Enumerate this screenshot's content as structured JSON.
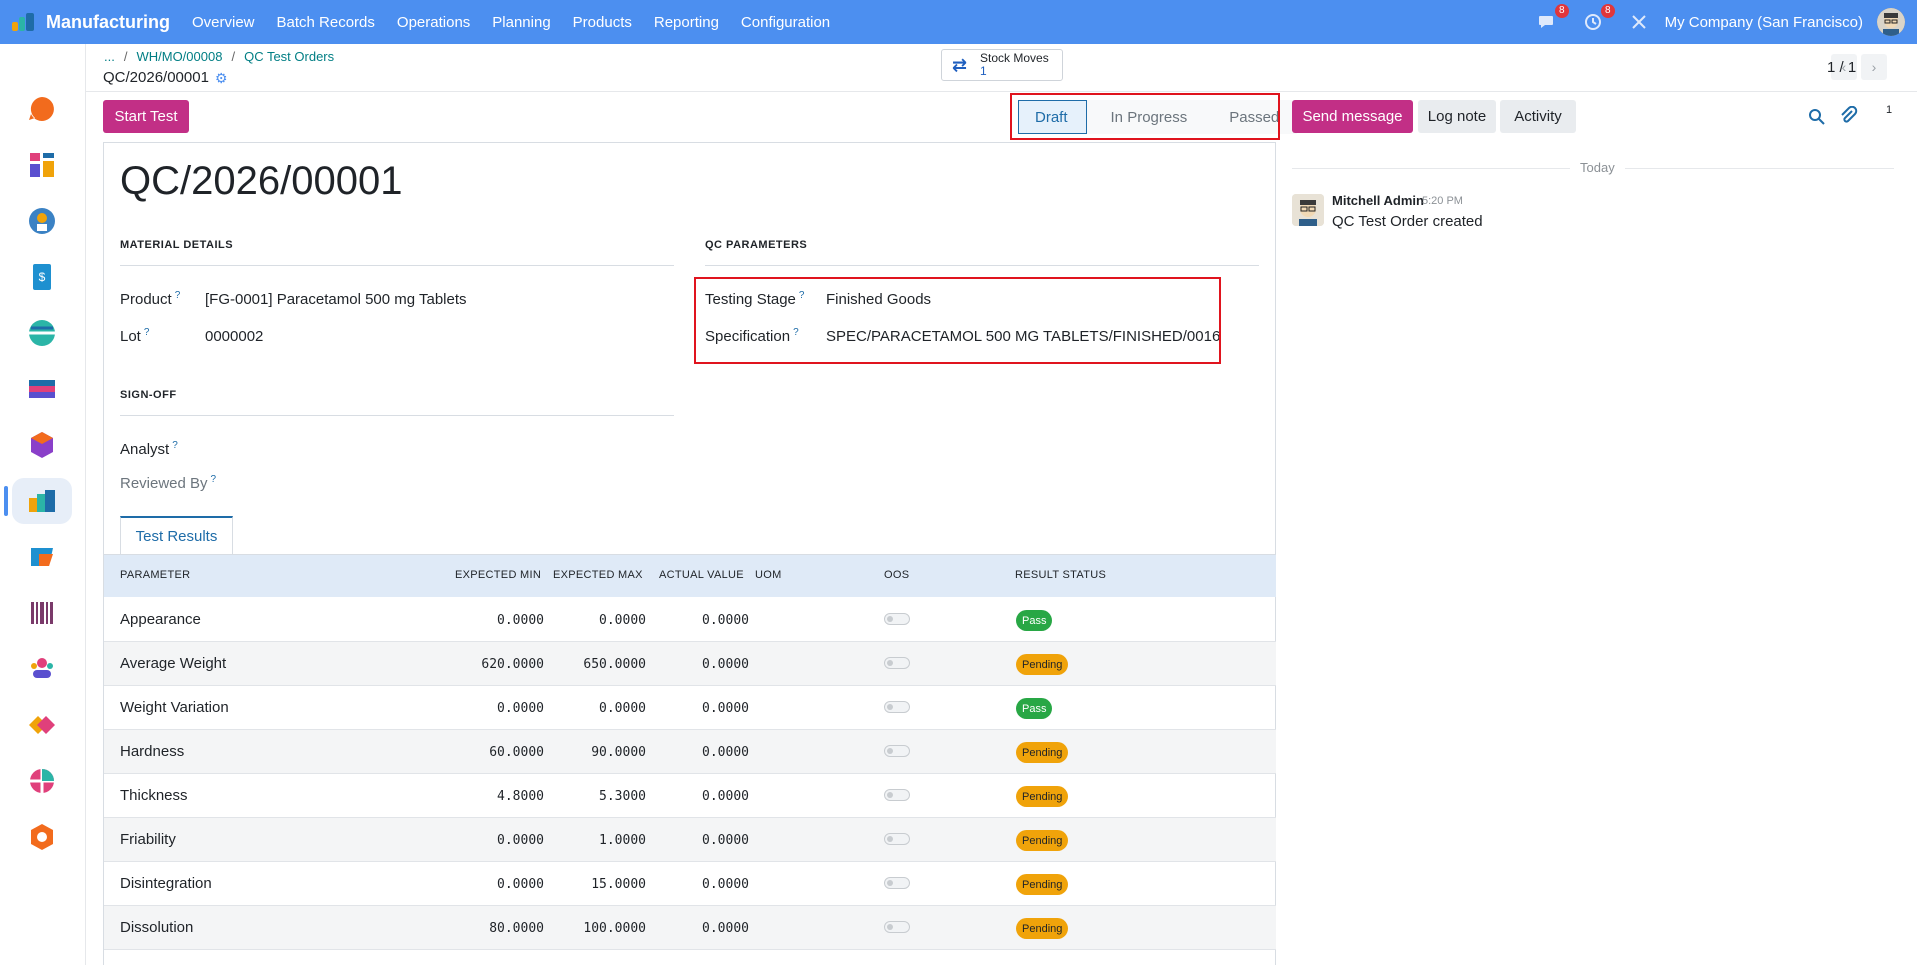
{
  "navbar": {
    "app_name": "Manufacturing",
    "menu": [
      "Overview",
      "Batch Records",
      "Operations",
      "Planning",
      "Products",
      "Reporting",
      "Configuration"
    ],
    "messages_badge": "8",
    "activities_badge": "8",
    "company": "My Company (San Francisco)",
    "brand_color": "#4c8ff0"
  },
  "breadcrumb": {
    "ellipsis": "...",
    "items": [
      "WH/MO/00008",
      "QC Test Orders"
    ],
    "current": "QC/2026/00001"
  },
  "smart_button": {
    "label": "Stock Moves",
    "count": "1"
  },
  "pager": {
    "value": "1 / 1"
  },
  "actions": {
    "start_test": "Start Test"
  },
  "status": {
    "stages": [
      "Draft",
      "In Progress",
      "Passed"
    ],
    "active": "Draft"
  },
  "chatter_actions": {
    "send_message": "Send message",
    "log_note": "Log note",
    "activity": "Activity",
    "attachments_count": "1"
  },
  "form": {
    "title": "QC/2026/00001",
    "material_details": {
      "heading": "MATERIAL DETAILS",
      "product_label": "Product",
      "product_value": "[FG-0001] Paracetamol 500 mg Tablets",
      "lot_label": "Lot",
      "lot_value": "0000002"
    },
    "qc_parameters": {
      "heading": "QC PARAMETERS",
      "stage_label": "Testing Stage",
      "stage_value": "Finished Goods",
      "spec_label": "Specification",
      "spec_value": "SPEC/PARACETAMOL 500 MG TABLETS/FINISHED/0016"
    },
    "signoff": {
      "heading": "SIGN-OFF",
      "analyst_label": "Analyst",
      "reviewed_label": "Reviewed By"
    },
    "help_mark": "?"
  },
  "tabs": {
    "test_results": "Test Results"
  },
  "table": {
    "headers": [
      "PARAMETER",
      "EXPECTED MIN",
      "EXPECTED MAX",
      "ACTUAL VALUE",
      "UOM",
      "OOS",
      "RESULT STATUS"
    ],
    "rows": [
      {
        "parameter": "Appearance",
        "min": "0.0000",
        "max": "0.0000",
        "actual": "0.0000",
        "status": "Pass"
      },
      {
        "parameter": "Average Weight",
        "min": "620.0000",
        "max": "650.0000",
        "actual": "0.0000",
        "status": "Pending"
      },
      {
        "parameter": "Weight Variation",
        "min": "0.0000",
        "max": "0.0000",
        "actual": "0.0000",
        "status": "Pass"
      },
      {
        "parameter": "Hardness",
        "min": "60.0000",
        "max": "90.0000",
        "actual": "0.0000",
        "status": "Pending"
      },
      {
        "parameter": "Thickness",
        "min": "4.8000",
        "max": "5.3000",
        "actual": "0.0000",
        "status": "Pending"
      },
      {
        "parameter": "Friability",
        "min": "0.0000",
        "max": "1.0000",
        "actual": "0.0000",
        "status": "Pending"
      },
      {
        "parameter": "Disintegration",
        "min": "0.0000",
        "max": "15.0000",
        "actual": "0.0000",
        "status": "Pending"
      },
      {
        "parameter": "Dissolution",
        "min": "80.0000",
        "max": "100.0000",
        "actual": "0.0000",
        "status": "Pending"
      }
    ]
  },
  "chatter": {
    "date_separator": "Today",
    "author": "Mitchell Admin",
    "time": "5:20 PM",
    "body": "QC Test Order created"
  }
}
